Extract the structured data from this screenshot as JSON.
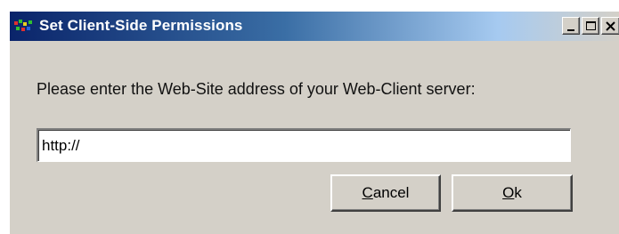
{
  "window": {
    "title": "Set Client-Side Permissions",
    "icon": "app-icon"
  },
  "title_buttons": {
    "minimize_icon": "minimize-icon",
    "maximize_icon": "maximize-icon",
    "close_icon": "close-icon"
  },
  "dialog": {
    "prompt": "Please enter the Web-Site address of your Web-Client server:",
    "url_value": "http://"
  },
  "buttons": {
    "cancel_label": "Cancel",
    "ok_label": "Ok"
  },
  "colors": {
    "titlebar_start": "#0a246a",
    "titlebar_end": "#a6caf0",
    "window_face": "#d4d0c8"
  }
}
